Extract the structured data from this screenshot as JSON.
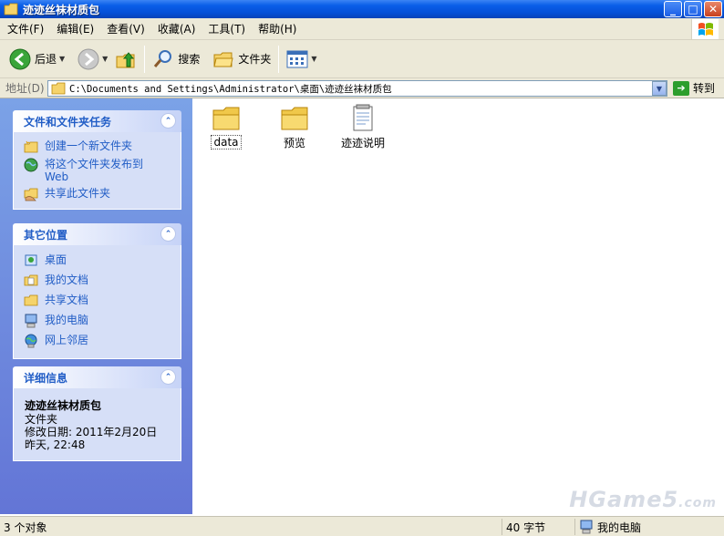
{
  "window": {
    "title": "迹迹丝袜材质包"
  },
  "menu": [
    "文件(F)",
    "编辑(E)",
    "查看(V)",
    "收藏(A)",
    "工具(T)",
    "帮助(H)"
  ],
  "toolbar": {
    "back_label": "后退",
    "search_label": "搜索",
    "folders_label": "文件夹"
  },
  "address": {
    "label": "地址(D)",
    "path": "C:\\Documents and Settings\\Administrator\\桌面\\迹迹丝袜材质包",
    "go_label": "转到"
  },
  "sidebar": {
    "tasks": {
      "title": "文件和文件夹任务",
      "items": [
        "创建一个新文件夹",
        "将这个文件夹发布到\nWeb",
        "共享此文件夹"
      ]
    },
    "places": {
      "title": "其它位置",
      "items": [
        "桌面",
        "我的文档",
        "共享文档",
        "我的电脑",
        "网上邻居"
      ]
    },
    "details": {
      "title": "详细信息",
      "name": "迹迹丝袜材质包",
      "type": "文件夹",
      "modified_label": "修改日期: 2011年2月20日",
      "modified_time": "昨天, 22:48"
    }
  },
  "files": [
    {
      "name": "data",
      "kind": "folder-icon"
    },
    {
      "name": "预览",
      "kind": "folder-icon"
    },
    {
      "name": "迹迹说明",
      "kind": "text-file-icon"
    }
  ],
  "status": {
    "count": "3 个对象",
    "size": "40 字节",
    "location": "我的电脑"
  },
  "watermark": {
    "main": "HGame5",
    "suffix": ".com"
  },
  "colors": {
    "title_blue": "#0550d8",
    "link_blue": "#215dc6",
    "sidebar_top": "#7ba2e7",
    "chrome": "#ece9d8"
  }
}
